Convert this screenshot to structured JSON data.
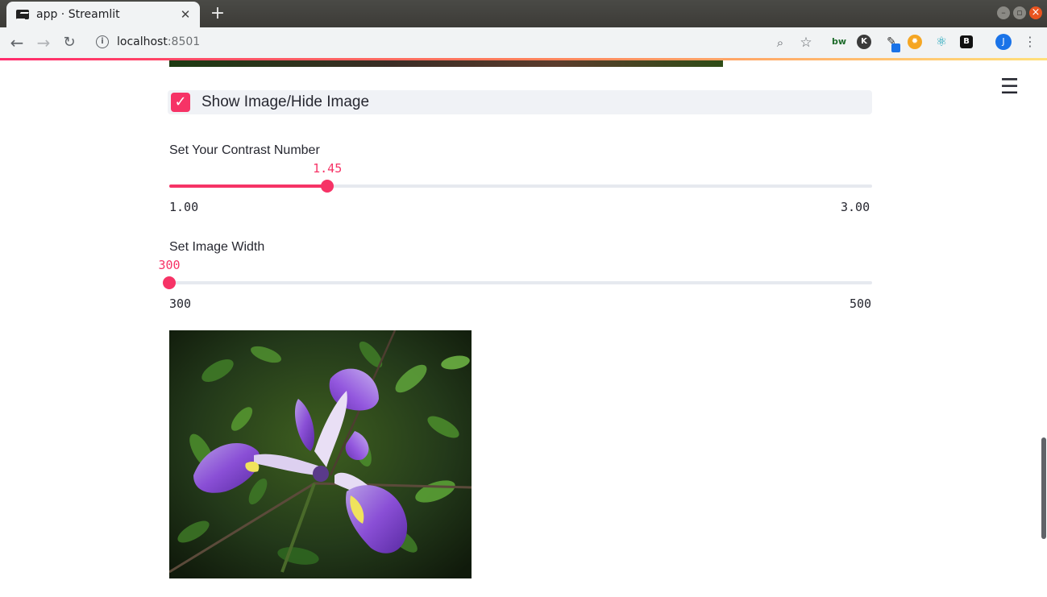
{
  "browser": {
    "tab_title": "app · Streamlit",
    "url_host": "localhost",
    "url_port": ":8501",
    "profile_initial": "J"
  },
  "app": {
    "checkbox": {
      "label": "Show Image/Hide Image",
      "checked": true
    },
    "contrast_slider": {
      "label": "Set Your Contrast Number",
      "value": "1.45",
      "min": "1.00",
      "max": "3.00",
      "fraction": 0.225
    },
    "width_slider": {
      "label": "Set Image Width",
      "value": "300",
      "min": "300",
      "max": "500",
      "fraction": 0.0
    },
    "image": {
      "subject": "iris flower"
    },
    "accent_color": "#f63366"
  }
}
